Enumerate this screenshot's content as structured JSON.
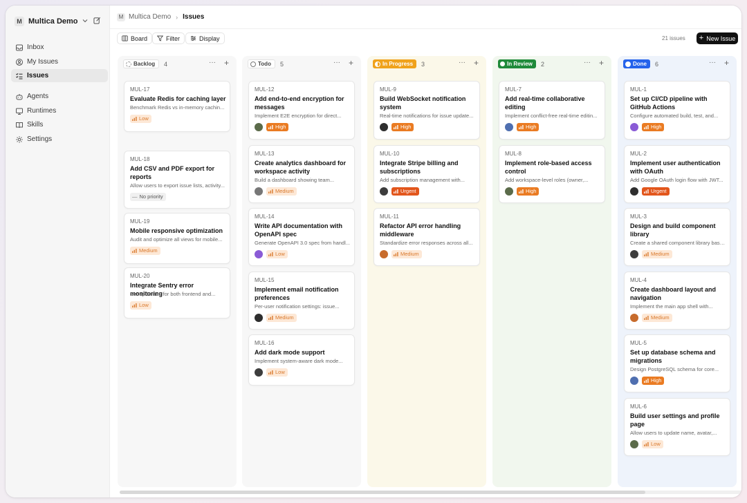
{
  "workspace": {
    "badge": "M",
    "name": "Multica Demo"
  },
  "sidebar": {
    "items": [
      {
        "label": "Inbox",
        "icon": "inbox-icon"
      },
      {
        "label": "My Issues",
        "icon": "user-circle-icon"
      },
      {
        "label": "Issues",
        "icon": "list-icon",
        "active": true
      },
      {
        "label": "Agents",
        "icon": "bot-icon"
      },
      {
        "label": "Runtimes",
        "icon": "monitor-icon"
      },
      {
        "label": "Skills",
        "icon": "book-icon"
      },
      {
        "label": "Settings",
        "icon": "gear-icon"
      }
    ]
  },
  "breadcrumb": {
    "badge": "M",
    "workspace": "Multica Demo",
    "current": "Issues"
  },
  "toolbar": {
    "board": "Board",
    "filter": "Filter",
    "display": "Display",
    "count": "21 issues",
    "new_issue": "New Issue"
  },
  "colors": {
    "low": "#d9782b",
    "high": "#ea7b22",
    "urgent": "#e2561c",
    "in_progress": "#f0a21b",
    "in_review": "#1f8a3a",
    "done": "#2563eb"
  },
  "columns": [
    {
      "status": "Backlog",
      "count": "4",
      "cards": [
        {
          "id": "MUL-17",
          "title": "Evaluate Redis for caching layer",
          "desc": "Benchmark Redis vs in-memory cachin...",
          "priority": "Low",
          "level": "low"
        },
        {
          "id": "MUL-18",
          "title": "Add CSV and PDF export for reports",
          "desc": "Allow users to export issue lists, activity...",
          "priority": "No priority",
          "level": "none"
        },
        {
          "id": "MUL-19",
          "title": "Mobile responsive optimization",
          "desc": "Audit and optimize all views for mobile...",
          "priority": "Medium",
          "level": "medium"
        },
        {
          "id": "MUL-20",
          "title": "Integrate Sentry error monitoring",
          "desc": "Set up Sentry for both frontend and...",
          "priority": "Low",
          "level": "low"
        }
      ]
    },
    {
      "status": "Todo",
      "count": "5",
      "cards": [
        {
          "id": "MUL-12",
          "title": "Add end-to-end encryption for messages",
          "desc": "Implement E2E encryption for direct...",
          "priority": "High",
          "level": "high"
        },
        {
          "id": "MUL-13",
          "title": "Create analytics dashboard for workspace activity",
          "desc": "Build a dashboard showing team...",
          "priority": "Medium",
          "level": "medium"
        },
        {
          "id": "MUL-14",
          "title": "Write API documentation with OpenAPI spec",
          "desc": "Generate OpenAPI 3.0 spec from handl...",
          "priority": "Low",
          "level": "low"
        },
        {
          "id": "MUL-15",
          "title": "Implement email notification preferences",
          "desc": "Per-user notification settings: issue...",
          "priority": "Medium",
          "level": "medium"
        },
        {
          "id": "MUL-16",
          "title": "Add dark mode support",
          "desc": "Implement system-aware dark mode...",
          "priority": "Low",
          "level": "low"
        }
      ]
    },
    {
      "status": "In Progress",
      "count": "3",
      "cards": [
        {
          "id": "MUL-9",
          "title": "Build WebSocket notification system",
          "desc": "Real-time notifications for issue update...",
          "priority": "High",
          "level": "high"
        },
        {
          "id": "MUL-10",
          "title": "Integrate Stripe billing and subscriptions",
          "desc": "Add subscription management with...",
          "priority": "Urgent",
          "level": "urgent"
        },
        {
          "id": "MUL-11",
          "title": "Refactor API error handling middleware",
          "desc": "Standardize error responses across all...",
          "priority": "Medium",
          "level": "medium"
        }
      ]
    },
    {
      "status": "In Review",
      "count": "2",
      "cards": [
        {
          "id": "MUL-7",
          "title": "Add real-time collaborative editing",
          "desc": "Implement conflict-free real-time editin...",
          "priority": "High",
          "level": "high"
        },
        {
          "id": "MUL-8",
          "title": "Implement role-based access control",
          "desc": "Add workspace-level roles (owner,...",
          "priority": "High",
          "level": "high"
        }
      ]
    },
    {
      "status": "Done",
      "count": "6",
      "cards": [
        {
          "id": "MUL-1",
          "title": "Set up CI/CD pipeline with GitHub Actions",
          "desc": "Configure automated build, test, and...",
          "priority": "High",
          "level": "high"
        },
        {
          "id": "MUL-2",
          "title": "Implement user authentication with OAuth",
          "desc": "Add Google OAuth login flow with JWT...",
          "priority": "Urgent",
          "level": "urgent"
        },
        {
          "id": "MUL-3",
          "title": "Design and build component library",
          "desc": "Create a shared component library base...",
          "priority": "Medium",
          "level": "medium"
        },
        {
          "id": "MUL-4",
          "title": "Create dashboard layout and navigation",
          "desc": "Implement the main app shell with...",
          "priority": "Medium",
          "level": "medium"
        },
        {
          "id": "MUL-5",
          "title": "Set up database schema and migrations",
          "desc": "Design PostgreSQL schema for core...",
          "priority": "High",
          "level": "high"
        },
        {
          "id": "MUL-6",
          "title": "Build user settings and profile page",
          "desc": "Allow users to update name, avatar,...",
          "priority": "Low",
          "level": "low"
        }
      ]
    }
  ]
}
